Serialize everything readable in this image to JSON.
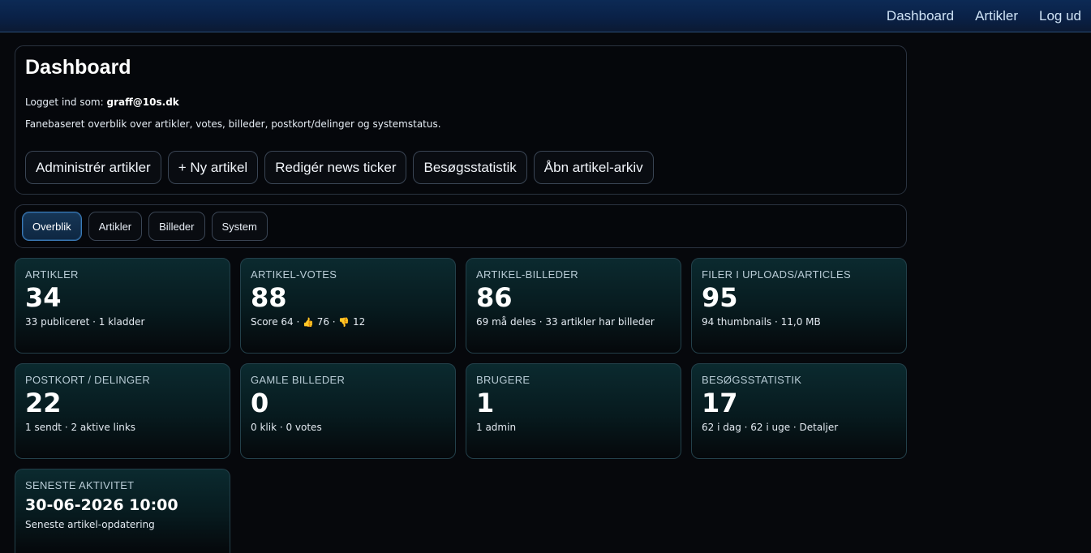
{
  "nav": {
    "dashboard": "Dashboard",
    "articles": "Artikler",
    "logout": "Log ud"
  },
  "header": {
    "title": "Dashboard",
    "logged_in_prefix": "Logget ind som:",
    "logged_in_user": "graff@10s.dk",
    "description": "Fanebaseret overblik over artikler, votes, billeder, postkort/delinger og systemstatus."
  },
  "actions": [
    "Administrér artikler",
    "+ Ny artikel",
    "Redigér news ticker",
    "Besøgsstatistik",
    "Åbn artikel-arkiv"
  ],
  "tabs": {
    "active": "Overblik",
    "items": [
      "Overblik",
      "Artikler",
      "Billeder",
      "System"
    ]
  },
  "stats": {
    "articles": {
      "label": "ARTIKLER",
      "value": "34",
      "sub": "33 publiceret · 1 kladder"
    },
    "votes": {
      "label": "ARTIKEL-VOTES",
      "value": "88",
      "sub_score": "Score 64 ·",
      "up_icon": "thumbs-up-icon",
      "up_glyph": "👍",
      "up": "76 ·",
      "down_icon": "thumbs-down-icon",
      "down_glyph": "👎",
      "down": "12"
    },
    "images": {
      "label": "ARTIKEL-BILLEDER",
      "value": "86",
      "sub": "69 må deles · 33 artikler har billeder"
    },
    "uploads": {
      "label": "FILER I UPLOADS/ARTICLES",
      "value": "95",
      "sub": "94 thumbnails · 11,0 MB"
    },
    "postcards": {
      "label": "POSTKORT / DELINGER",
      "value": "22",
      "sub": "1 sendt · 2 aktive links"
    },
    "old_images": {
      "label": "GAMLE BILLEDER",
      "value": "0",
      "sub": "0 klik · 0 votes"
    },
    "users": {
      "label": "BRUGERE",
      "value": "1",
      "sub": "1 admin"
    },
    "visits": {
      "label": "BESØGSSTATISTIK",
      "value": "17",
      "sub": "62 i dag · 62 i uge · Detaljer"
    },
    "latest": {
      "label": "SENESTE AKTIVITET",
      "value": "30-06-2026 10:00",
      "sub": "Seneste artikel-opdatering"
    }
  },
  "colors": {
    "topbar": "#0a2147",
    "background": "#06080c",
    "active_tab_border": "#3b7bb8"
  }
}
